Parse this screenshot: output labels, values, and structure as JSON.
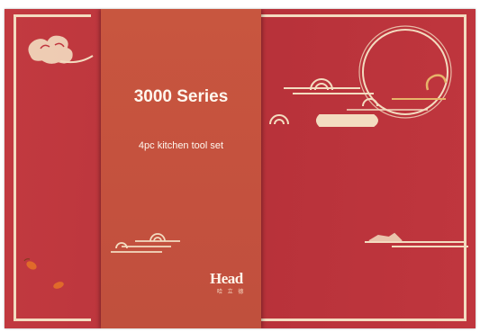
{
  "product": {
    "title": "3000 Series",
    "subtitle": "4pc kitchen tool set",
    "brand_name": "Head",
    "brand_sub": "哈 立 德"
  },
  "colors": {
    "box_red": "#c0363e",
    "band": "#c4513e",
    "cream": "#f3dcc0",
    "gold": "#e7b46a"
  },
  "decorations": [
    "cloud-swirl",
    "sun-circle",
    "cloud-wave",
    "cloud-streak",
    "chili-pepper"
  ]
}
